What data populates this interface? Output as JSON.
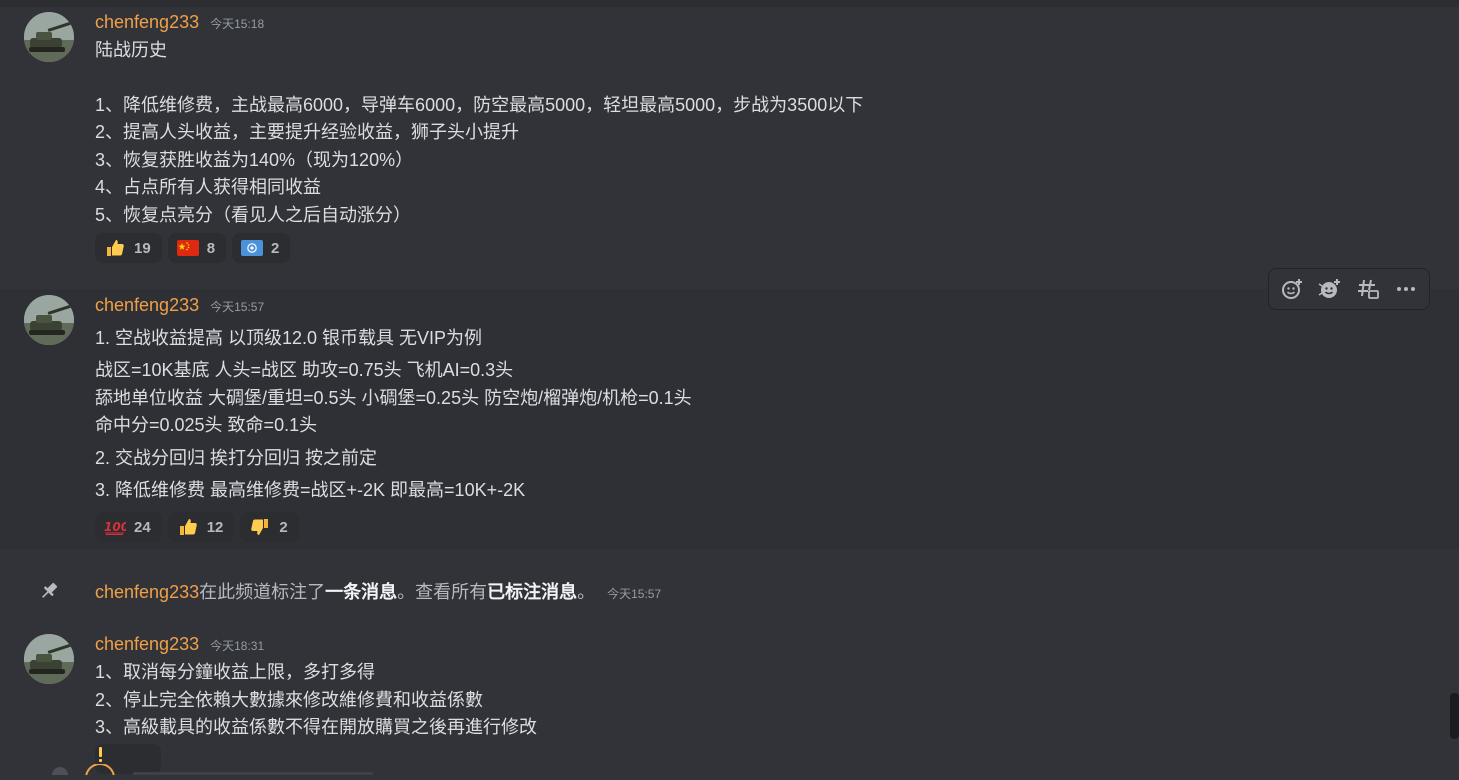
{
  "messages": [
    {
      "author": "chenfeng233",
      "time": "今天15:18",
      "lines": [
        "陆战历史",
        "",
        "1、降低维修费，主战最高6000，导弹车6000，防空最高5000，轻坦最高5000，步战为3500以下",
        "2、提高人头收益，主要提升经验收益，狮子头小提升",
        "3、恢复获胜收益为140%（现为120%）",
        "4、占点所有人获得相同收益",
        "5、恢复点亮分（看见人之后自动涨分）"
      ],
      "reactions": [
        {
          "emoji": "thumbs-up-icon",
          "count": "19"
        },
        {
          "emoji": "china-flag-icon",
          "count": "8"
        },
        {
          "emoji": "un-flag-icon",
          "count": "2"
        }
      ]
    },
    {
      "author": "chenfeng233",
      "time": "今天15:57",
      "lines": [
        "1. 空战收益提高 以顶级12.0 银币载具 无VIP为例",
        "战区=10K基底 人头=战区 助攻=0.75头 飞机AI=0.3头",
        "舔地单位收益 大碉堡/重坦=0.5头 小碉堡=0.25头 防空炮/榴弹炮/机枪=0.1头",
        "命中分=0.025头 致命=0.1头",
        "2. 交战分回归 挨打分回归 按之前定",
        "3. 降低维修费 最高维修费=战区+-2K 即最高=10K+-2K"
      ],
      "reactions": [
        {
          "emoji": "hundred-points-icon",
          "count": "24"
        },
        {
          "emoji": "thumbs-up-icon",
          "count": "12"
        },
        {
          "emoji": "thumbs-down-icon",
          "count": "2"
        }
      ]
    },
    {
      "author": "chenfeng233",
      "time": "今天18:31",
      "lines": [
        "1、取消每分鐘收益上限，多打多得",
        "2、停止完全依賴大數據來修改維修費和收益係數",
        "3、高級載具的收益係數不得在開放購買之後再進行修改"
      ]
    }
  ],
  "pin_notice": {
    "author": "chenfeng233",
    "text1": "在此频道标注了",
    "link1": "一条消息",
    "text2": "。查看所有",
    "link2": "已标注消息",
    "text3": "。",
    "time": "今天15:57"
  },
  "toolbar": {
    "buttons": [
      "add-reaction-icon",
      "super-reaction-icon",
      "create-thread-icon",
      "more-icon"
    ]
  },
  "colors": {
    "background": "#313338",
    "username": "#f0a048",
    "text": "#dbdee1",
    "muted": "#949ba4"
  }
}
